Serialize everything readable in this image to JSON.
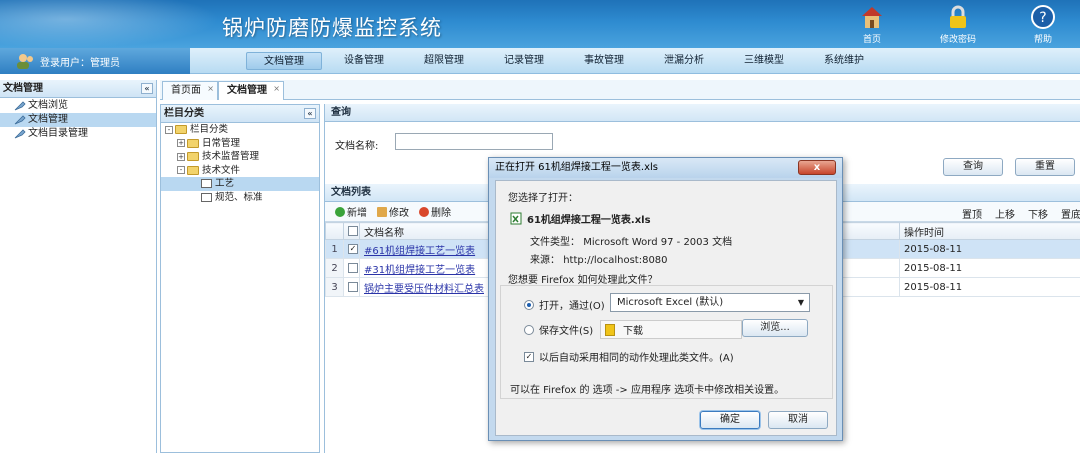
{
  "header": {
    "title": "锅炉防磨防爆监控系统",
    "buttons": [
      {
        "label": "首页",
        "icon": "home-icon"
      },
      {
        "label": "修改密码",
        "icon": "lock-icon"
      },
      {
        "label": "帮助",
        "icon": "help-icon"
      }
    ]
  },
  "user": {
    "label": "登录用户：管理员"
  },
  "menu": [
    "文档管理",
    "设备管理",
    "超限管理",
    "记录管理",
    "事故管理",
    "泄漏分析",
    "三维模型",
    "系统维护"
  ],
  "left_panel": {
    "title": "文档管理",
    "collapse": "«",
    "items": [
      "文档浏览",
      "文档管理",
      "文档目录管理"
    ]
  },
  "tabs": [
    {
      "label": "首页面",
      "close": "×"
    },
    {
      "label": "文档管理",
      "close": "×"
    }
  ],
  "category": {
    "title": "栏目分类",
    "collapse": "«",
    "root": "栏目分类",
    "nodes": [
      "日常管理",
      "技术监督管理",
      "技术文件"
    ],
    "children": [
      "工艺",
      "规范、标准"
    ]
  },
  "query": {
    "title": "查询",
    "field_label": "文档名称:",
    "search_button": "查询",
    "reset_button": "重置"
  },
  "list": {
    "title": "文档列表",
    "add": "新增",
    "edit": "修改",
    "delete": "删除",
    "nav": [
      "置顶",
      "上移",
      "下移",
      "置底"
    ],
    "columns": {
      "name": "文档名称",
      "time": "操作时间"
    },
    "rows": [
      {
        "num": "1",
        "name": "#61机组焊接工艺一览表",
        "time": "2015-08-11"
      },
      {
        "num": "2",
        "name": "#31机组焊接工艺一览表",
        "time": "2015-08-11"
      },
      {
        "num": "3",
        "name": "锅炉主要受压件材料汇总表",
        "time": "2015-08-11"
      }
    ]
  },
  "dialog": {
    "title": "正在打开 61机组焊接工程一览表.xls",
    "close": "x",
    "chosen": "您选择了打开：",
    "filename": "61机组焊接工程一览表.xls",
    "type_label": "文件类型：",
    "type_value": "Microsoft Word 97 - 2003 文档",
    "source_label": "来源：",
    "source_value": "http://localhost:8080",
    "question": "您想要 Firefox 如何处理此文件？",
    "open_with": "打开，通过(O)",
    "app": "Microsoft Excel (默认)",
    "save": "保存文件(S)",
    "download": "下载",
    "browse": "浏览...",
    "auto": "以后自动采用相同的动作处理此类文件。(A)",
    "hint": "可以在 Firefox 的 选项 -> 应用程序 选项卡中修改相关设置。",
    "ok": "确定",
    "cancel": "取消"
  },
  "colors": {
    "header": "#2e8bd0",
    "accent": "#1d5fb0",
    "link": "#2a34a8"
  }
}
